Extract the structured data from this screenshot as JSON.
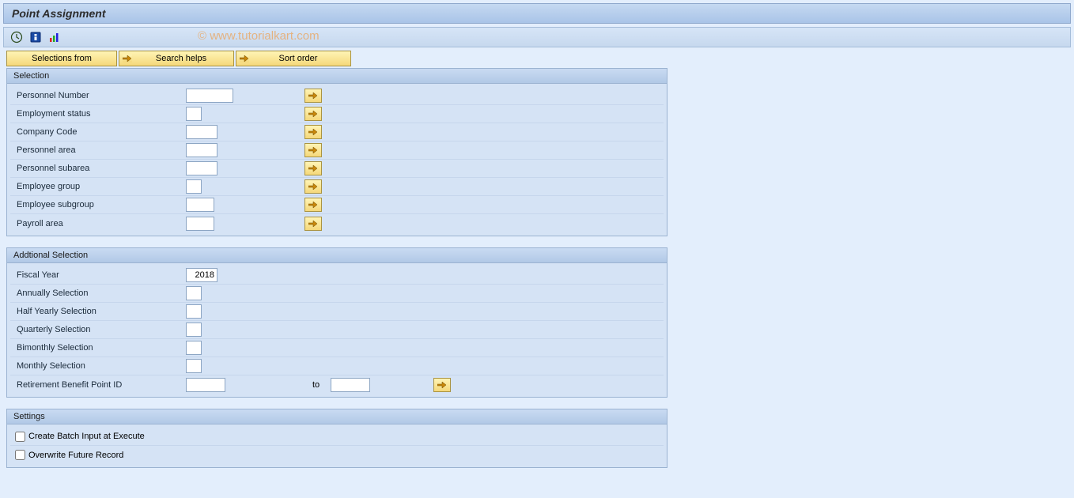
{
  "title": "Point Assignment",
  "watermark": "© www.tutorialkart.com",
  "toolbar": {
    "icons": [
      "execute",
      "variant",
      "stats"
    ]
  },
  "action_buttons": {
    "selections_from": "Selections from",
    "search_helps": "Search helps",
    "sort_order": "Sort order"
  },
  "groups": {
    "selection": {
      "title": "Selection",
      "fields": {
        "personnel_number": {
          "label": "Personnel Number",
          "value": ""
        },
        "employment_status": {
          "label": "Employment status",
          "value": ""
        },
        "company_code": {
          "label": "Company Code",
          "value": ""
        },
        "personnel_area": {
          "label": "Personnel area",
          "value": ""
        },
        "personnel_subarea": {
          "label": "Personnel subarea",
          "value": ""
        },
        "employee_group": {
          "label": "Employee group",
          "value": ""
        },
        "employee_subgroup": {
          "label": "Employee subgroup",
          "value": ""
        },
        "payroll_area": {
          "label": "Payroll area",
          "value": ""
        }
      }
    },
    "additional": {
      "title": "Addtional Selection",
      "fields": {
        "fiscal_year": {
          "label": "Fiscal Year",
          "value": "2018"
        },
        "annually": {
          "label": "Annually Selection",
          "value": ""
        },
        "half_yearly": {
          "label": "Half Yearly Selection",
          "value": ""
        },
        "quarterly": {
          "label": "Quarterly Selection",
          "value": ""
        },
        "bimonthly": {
          "label": "Bimonthly Selection",
          "value": ""
        },
        "monthly": {
          "label": "Monthly Selection",
          "value": ""
        },
        "retirement_id": {
          "label": "Retirement Benefit Point ID",
          "value": "",
          "to_label": "to",
          "to_value": ""
        }
      }
    },
    "settings": {
      "title": "Settings",
      "checks": {
        "batch_input": {
          "label": "Create Batch Input at Execute",
          "checked": false
        },
        "overwrite": {
          "label": "Overwrite Future Record",
          "checked": false
        }
      }
    }
  }
}
